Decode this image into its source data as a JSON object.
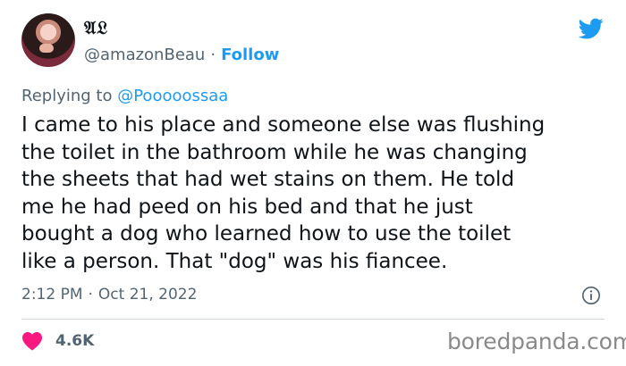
{
  "tweet": {
    "display_name": "𝔄𝔏",
    "handle": "@amazonBeau",
    "separator": "·",
    "follow_label": "Follow",
    "replying_to_label": "Replying to",
    "replying_to_handle": "@Pooooossaa",
    "text": "I came to his place and someone else was flushing\nthe toilet in the bathroom while he was changing\nthe sheets that had wet stains on them. He told\nme he had peed on his bed and that he just\nbought a dog who learned how to use the toilet\nlike a person. That \"dog\" was his fiancee.",
    "time": "2:12 PM",
    "date": "Oct 21, 2022",
    "likes": "4.6K"
  },
  "icons": {
    "brand": "twitter-bird-icon",
    "info": "info-icon",
    "like": "heart-icon"
  },
  "watermark": "boredpanda.com",
  "colors": {
    "accent": "#1d9bf0",
    "heart": "#f91880",
    "secondary_text": "#536471",
    "text": "#0f1419"
  }
}
